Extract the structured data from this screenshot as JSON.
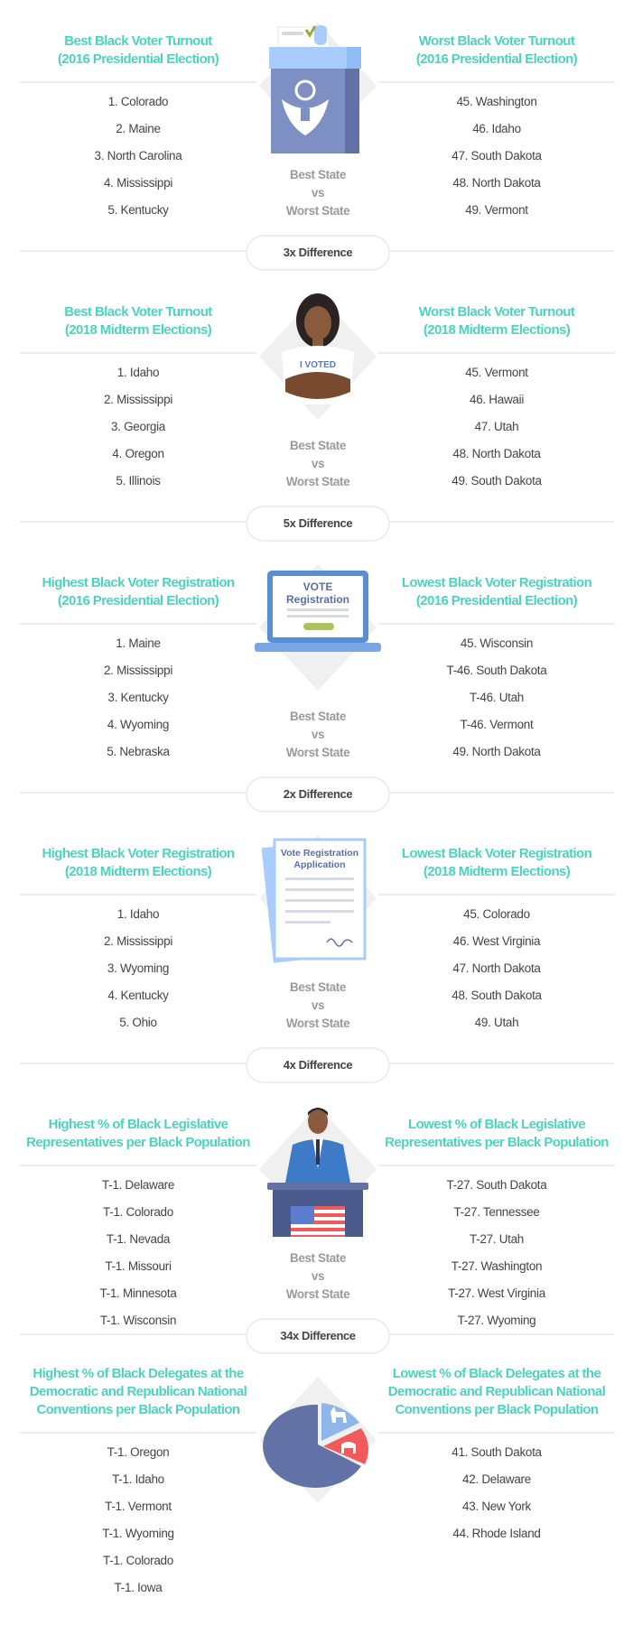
{
  "colors": {
    "heading": "#4cd3bd",
    "text": "#444444",
    "muted": "#9a9a9a"
  },
  "best_vs_worst": {
    "best": "Best State",
    "vs": "vs",
    "worst": "Worst State"
  },
  "sections": [
    {
      "illustration": "ballot-box-icon",
      "left": {
        "title": [
          "Best Black Voter Turnout",
          "(2016 Presidential Election)"
        ],
        "items": [
          "1. Colorado",
          "2. Maine",
          "3. North Carolina",
          "4. Mississippi",
          "5. Kentucky"
        ]
      },
      "right": {
        "title": [
          "Worst Black Voter Turnout",
          "(2016 Presidential Election)"
        ],
        "items": [
          "45. Washington",
          "46. Idaho",
          "47. South Dakota",
          "48. North Dakota",
          "49. Vermont"
        ]
      },
      "difference": "3x Difference"
    },
    {
      "illustration": "i-voted-woman-icon",
      "illustration_text": "I VOTED",
      "left": {
        "title": [
          "Best Black Voter Turnout",
          "(2018 Midterm Elections)"
        ],
        "items": [
          "1. Idaho",
          "2. Mississippi",
          "3. Georgia",
          "4. Oregon",
          "5. Illinois"
        ]
      },
      "right": {
        "title": [
          "Worst Black Voter Turnout",
          "(2018 Midterm Elections)"
        ],
        "items": [
          "45. Vermont",
          "46. Hawaii",
          "47. Utah",
          "48. North Dakota",
          "49. South Dakota"
        ]
      },
      "difference": "5x Difference"
    },
    {
      "illustration": "laptop-vote-registration-icon",
      "illustration_text": [
        "VOTE",
        "Registration"
      ],
      "left": {
        "title": [
          "Highest Black Voter Registration",
          "(2016 Presidential Election)"
        ],
        "items": [
          "1. Maine",
          "2. Mississippi",
          "3. Kentucky",
          "4. Wyoming",
          "5. Nebraska"
        ]
      },
      "right": {
        "title": [
          "Lowest Black Voter Registration",
          "(2016 Presidential Election)"
        ],
        "items": [
          "45. Wisconsin",
          "T-46. South Dakota",
          "T-46. Utah",
          "T-46. Vermont",
          "49. North Dakota"
        ]
      },
      "difference": "2x Difference"
    },
    {
      "illustration": "registration-application-document-icon",
      "illustration_text": [
        "Vote Registration",
        "Application"
      ],
      "left": {
        "title": [
          "Highest Black Voter Registration",
          "(2018 Midterm Elections)"
        ],
        "items": [
          "1. Idaho",
          "2. Mississippi",
          "3. Wyoming",
          "4. Kentucky",
          "5. Ohio"
        ]
      },
      "right": {
        "title": [
          "Lowest Black Voter Registration",
          "(2018 Midterm Elections)"
        ],
        "items": [
          "45. Colorado",
          "46. West Virginia",
          "47. North Dakota",
          "48. South Dakota",
          "49. Utah"
        ]
      },
      "difference": "4x Difference"
    },
    {
      "illustration": "politician-podium-flag-icon",
      "left": {
        "title": [
          "Highest % of Black Legislative",
          "Representatives per Black Population"
        ],
        "items": [
          "T-1. Delaware",
          "T-1. Colorado",
          "T-1. Nevada",
          "T-1. Missouri",
          "T-1. Minnesota",
          "T-1. Wisconsin"
        ]
      },
      "right": {
        "title": [
          "Lowest % of Black Legislative",
          "Representatives per Black Population"
        ],
        "items": [
          "T-27. South Dakota",
          "T-27. Tennessee",
          "T-27. Utah",
          "T-27. Washington",
          "T-27. West Virginia",
          "T-27. Wyoming"
        ]
      },
      "difference": "34x Difference"
    },
    {
      "illustration": "party-pie-chart-icon",
      "left": {
        "title": [
          "Highest % of Black Delegates at the",
          "Democratic and Republican National",
          "Conventions per Black Population"
        ],
        "items": [
          "T-1. Oregon",
          "T-1. Idaho",
          "T-1. Vermont",
          "T-1. Wyoming",
          "T-1. Colorado",
          "T-1. Iowa"
        ]
      },
      "right": {
        "title": [
          "Lowest % of Black Delegates at the",
          "Democratic and Republican National",
          "Conventions per Black Population"
        ],
        "items": [
          "41. South Dakota",
          "42. Delaware",
          "43. New York",
          "44. Rhode Island"
        ]
      },
      "difference": null
    }
  ]
}
